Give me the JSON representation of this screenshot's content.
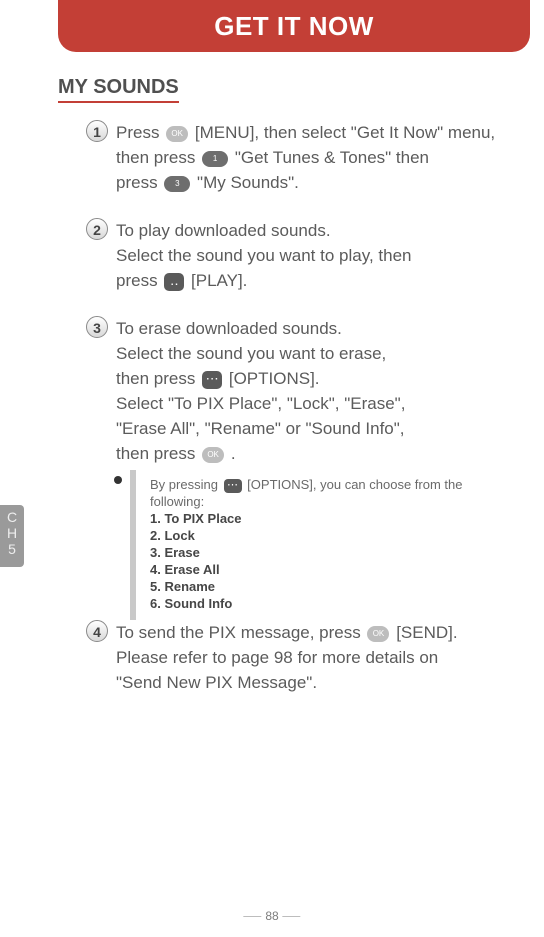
{
  "banner": "GET IT NOW",
  "section_title": "MY SOUNDS",
  "side_tab": {
    "line1": "C",
    "line2": "H",
    "line3": "5"
  },
  "keys": {
    "ok": "OK",
    "one": "1",
    "three": "3",
    "dots": "⋯",
    "twodots": "‥"
  },
  "steps": {
    "s1": {
      "num": "1",
      "t1": "Press ",
      "t2": " [MENU], then select \"Get It Now\" menu,",
      "t3": "then press ",
      "t4": " \"Get Tunes & Tones\" then",
      "t5": "press ",
      "t6": " \"My Sounds\"."
    },
    "s2": {
      "num": "2",
      "t1": "To play downloaded sounds.",
      "t2": "Select the sound you want to play, then",
      "t3": "press ",
      "t4": " [PLAY]."
    },
    "s3": {
      "num": "3",
      "t1": "To erase downloaded sounds.",
      "t2": "Select the sound you want to erase,",
      "t3": "then press ",
      "t4": " [OPTIONS].",
      "t5": "Select \"To PIX Place\", \"Lock\", \"Erase\",",
      "t6": "\"Erase All\", \"Rename\" or \"Sound Info\",",
      "t7": "then press ",
      "t8": " ."
    },
    "s4": {
      "num": "4",
      "t1": "To send the PIX message, press ",
      "t2": " [SEND].",
      "t3": "Please refer to page 98 for more details on",
      "t4": "\"Send New PIX Message\"."
    }
  },
  "note": {
    "intro1": "By pressing  ",
    "intro2": " [OPTIONS], you can choose from the following:",
    "items": {
      "i1": "1. To PIX Place",
      "i2": "2. Lock",
      "i3": "3. Erase",
      "i4": "4. Erase All",
      "i5": "5. Rename",
      "i6": "6. Sound Info"
    }
  },
  "page_number": "88"
}
